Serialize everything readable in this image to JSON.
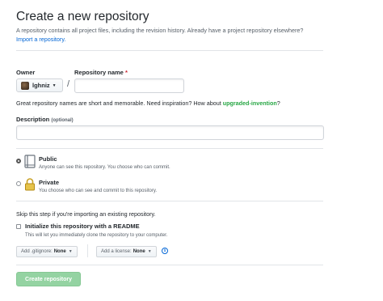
{
  "header": {
    "title": "Create a new repository",
    "subtitle": "A repository contains all project files, including the revision history. Already have a project repository elsewhere?",
    "import_link": "Import a repository."
  },
  "owner": {
    "label": "Owner",
    "value": "lghniz"
  },
  "repo_name": {
    "label": "Repository name",
    "required_mark": "*",
    "value": "",
    "separator": "/"
  },
  "hint": {
    "prefix": "Great repository names are short and memorable. Need inspiration? How about",
    "suggestion": "upgraded-invention",
    "suffix": "?"
  },
  "description": {
    "label": "Description",
    "optional": "(optional)",
    "value": ""
  },
  "visibility": {
    "selected": "public",
    "public": {
      "title": "Public",
      "desc": "Anyone can see this repository. You choose who can commit."
    },
    "private": {
      "title": "Private",
      "desc": "You choose who can see and commit to this repository."
    }
  },
  "init": {
    "skip_text": "Skip this step if you're importing an existing repository.",
    "readme_label": "Initialize this repository with a README",
    "readme_desc": "This will let you immediately clone the repository to your computer.",
    "readme_checked": false,
    "gitignore_prefix": "Add .gitignore:",
    "gitignore_value": "None",
    "license_prefix": "Add a license:",
    "license_value": "None",
    "info_glyph": "i"
  },
  "submit": {
    "label": "Create repository",
    "disabled": true
  },
  "colors": {
    "link": "#0366d6",
    "suggestion": "#28a745",
    "required": "#cb2431",
    "button_disabled": "#94d3a2"
  }
}
